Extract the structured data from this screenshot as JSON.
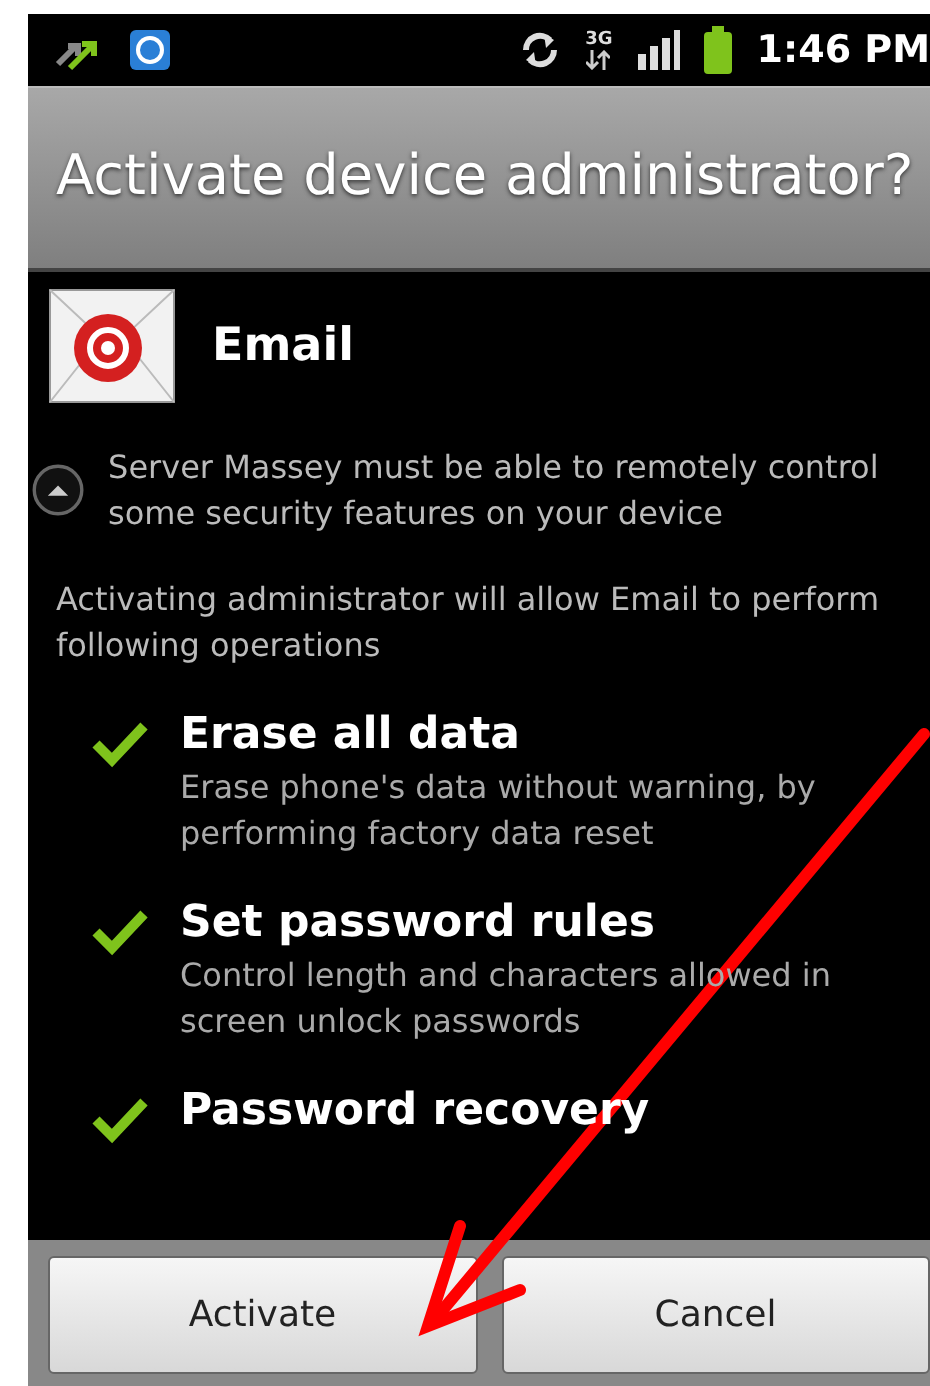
{
  "status_bar": {
    "network": "3G",
    "time": "1:46 PM"
  },
  "title": "Activate device administrator?",
  "app": {
    "name": "Email"
  },
  "warning": "Server Massey must be able to remotely control some security features on your device",
  "intro": "Activating administrator will allow Email to perform following operations",
  "policies": [
    {
      "title": "Erase all data",
      "description": "Erase phone's data without warning, by performing factory data reset"
    },
    {
      "title": "Set password rules",
      "description": "Control length and characters allowed in screen unlock passwords"
    },
    {
      "title": "Password recovery"
    }
  ],
  "buttons": [
    {
      "label": "Activate"
    },
    {
      "label": "Cancel"
    }
  ]
}
